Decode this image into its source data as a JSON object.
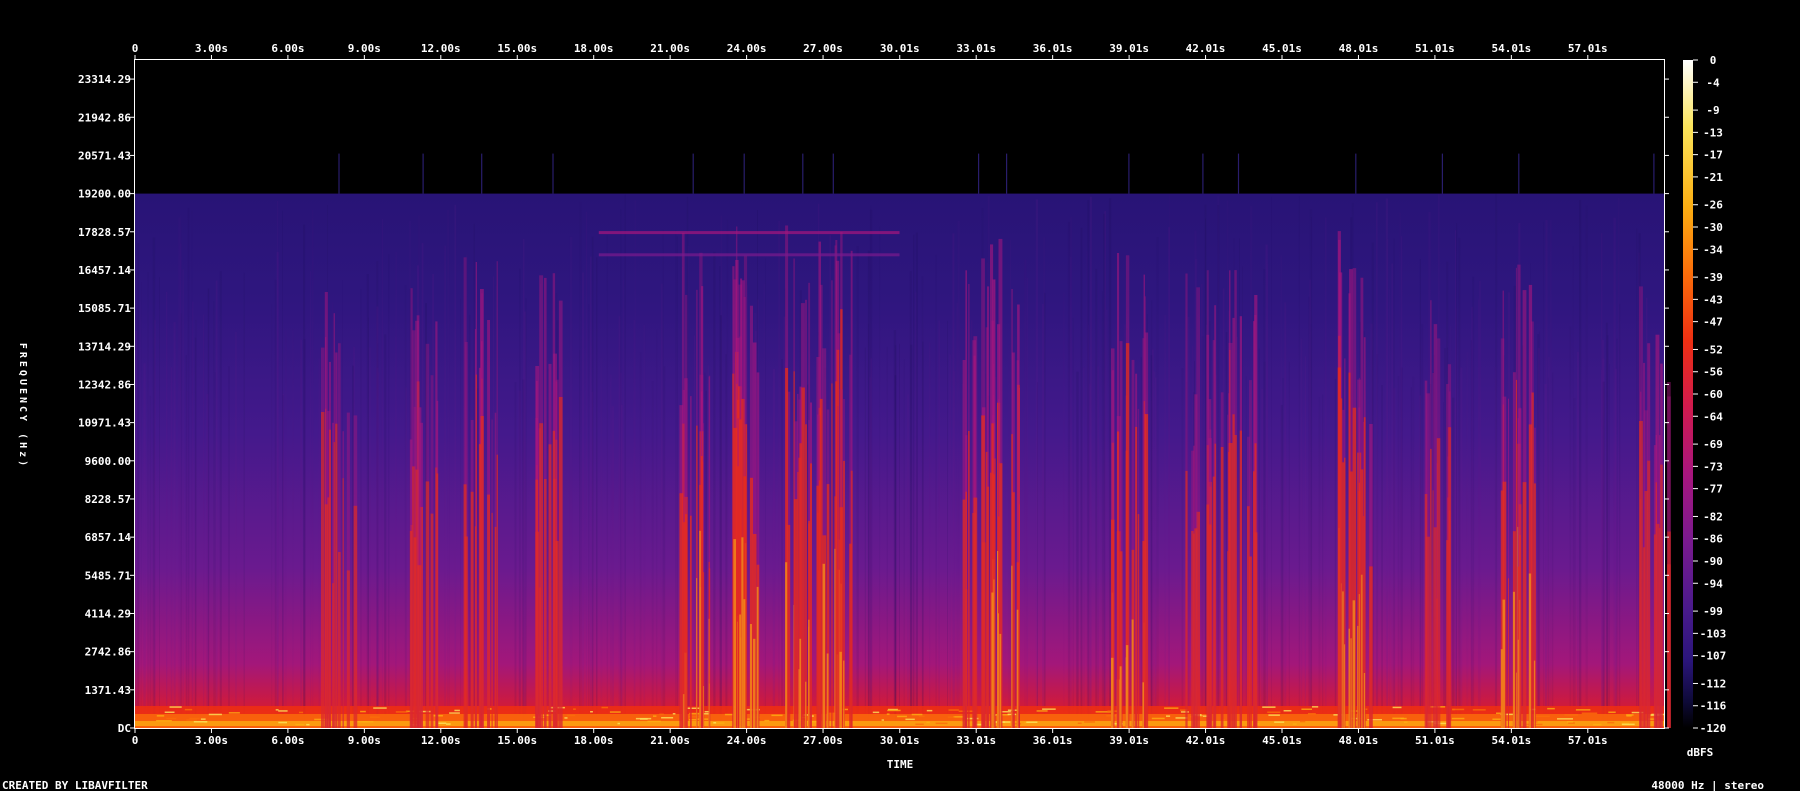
{
  "chart_data": {
    "type": "heatmap",
    "title": "",
    "xlabel": "TIME",
    "ylabel": "FREQUENCY (Hz)",
    "x_unit": "s",
    "x_ticks": [
      "0",
      "3.00s",
      "6.00s",
      "9.00s",
      "12.00s",
      "15.00s",
      "18.00s",
      "21.00s",
      "24.00s",
      "27.00s",
      "30.01s",
      "33.01s",
      "36.01s",
      "39.01s",
      "42.01s",
      "45.01s",
      "48.01s",
      "51.01s",
      "54.01s",
      "57.01s"
    ],
    "x_tick_values": [
      0,
      3.0,
      6.0,
      9.0,
      12.0,
      15.0,
      18.0,
      21.0,
      24.0,
      27.0,
      30.01,
      33.01,
      36.01,
      39.01,
      42.01,
      45.01,
      48.01,
      51.01,
      54.01,
      57.01
    ],
    "xlim": [
      0,
      60
    ],
    "y_ticks": [
      "DC",
      "1371.43",
      "2742.86",
      "4114.29",
      "5485.71",
      "6857.14",
      "8228.57",
      "9600.00",
      "10971.43",
      "12342.86",
      "13714.29",
      "15085.71",
      "16457.14",
      "17828.57",
      "19200.00",
      "20571.43",
      "21942.86",
      "23314.29"
    ],
    "y_tick_values": [
      0,
      1371.43,
      2742.86,
      4114.29,
      5485.71,
      6857.14,
      8228.57,
      9600.0,
      10971.43,
      12342.86,
      13714.29,
      15085.71,
      16457.14,
      17828.57,
      19200.0,
      20571.43,
      21942.86,
      23314.29
    ],
    "ylim": [
      0,
      24000
    ],
    "bandwidth_cutoff_hz": 19200,
    "colorbar": {
      "label": "dBFS",
      "ticks": [
        "0",
        "-4",
        "-9",
        "-13",
        "-17",
        "-21",
        "-26",
        "-30",
        "-34",
        "-39",
        "-43",
        "-47",
        "-52",
        "-56",
        "-60",
        "-64",
        "-69",
        "-73",
        "-77",
        "-82",
        "-86",
        "-90",
        "-94",
        "-99",
        "-103",
        "-107",
        "-112",
        "-116",
        "-120"
      ],
      "range": [
        -120,
        0
      ],
      "colors": [
        "#000000",
        "#0e0a38",
        "#2a157a",
        "#4a1a8c",
        "#7a1a8f",
        "#a8167e",
        "#d01a4e",
        "#ee2f12",
        "#fb6d0a",
        "#fcae12",
        "#fbe45a",
        "#ffffff"
      ]
    },
    "loud_events_s": [
      {
        "t": 8.0,
        "intensity": 0.55
      },
      {
        "t": 11.3,
        "intensity": 0.6
      },
      {
        "t": 13.6,
        "intensity": 0.7
      },
      {
        "t": 16.4,
        "intensity": 0.6
      },
      {
        "t": 21.9,
        "intensity": 0.8
      },
      {
        "t": 23.9,
        "intensity": 0.9
      },
      {
        "t": 26.2,
        "intensity": 0.85
      },
      {
        "t": 27.4,
        "intensity": 0.85
      },
      {
        "t": 33.1,
        "intensity": 0.7
      },
      {
        "t": 34.2,
        "intensity": 0.8
      },
      {
        "t": 39.0,
        "intensity": 0.8
      },
      {
        "t": 41.9,
        "intensity": 0.6
      },
      {
        "t": 43.3,
        "intensity": 0.7
      },
      {
        "t": 47.9,
        "intensity": 0.85
      },
      {
        "t": 51.3,
        "intensity": 0.5
      },
      {
        "t": 54.3,
        "intensity": 0.75
      },
      {
        "t": 59.6,
        "intensity": 0.55
      }
    ]
  },
  "footer": {
    "credit": "CREATED BY LIBAVFILTER",
    "format": "48000 Hz | stereo"
  }
}
